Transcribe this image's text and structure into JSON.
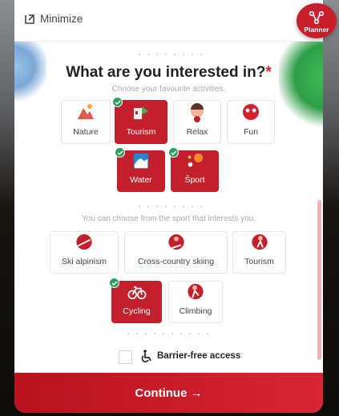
{
  "header": {
    "minimize_label": "Minimize",
    "planner_label": "Planner"
  },
  "main": {
    "title": "What are you interested in?",
    "required_mark": "*",
    "subtitle": "Choose your favourite activities.",
    "activities": [
      {
        "label": "Nature",
        "selected": false,
        "icon": "nature-icon"
      },
      {
        "label": "Tourism",
        "selected": true,
        "icon": "tourism-icon"
      },
      {
        "label": "Relax",
        "selected": false,
        "icon": "relax-icon"
      },
      {
        "label": "Fun",
        "selected": false,
        "icon": "fun-icon"
      },
      {
        "label": "Water",
        "selected": true,
        "icon": "water-icon"
      },
      {
        "label": "Šport",
        "selected": true,
        "icon": "sport-icon"
      }
    ],
    "sport_hint": "You can choose from the sport that interests you.",
    "sports": [
      {
        "label": "Ski alpinism",
        "selected": false,
        "icon": "ski-alpinism-icon"
      },
      {
        "label": "Cross-country skiing",
        "selected": false,
        "icon": "cross-country-skiing-icon"
      },
      {
        "label": "Tourism",
        "selected": false,
        "icon": "hiking-icon"
      },
      {
        "label": "Cycling",
        "selected": true,
        "icon": "cycling-icon"
      },
      {
        "label": "Climbing",
        "selected": false,
        "icon": "climbing-icon"
      }
    ],
    "barrier_free_label": "Barrier-free access",
    "continue_label": "Continue →"
  },
  "colors": {
    "accent": "#c3202c",
    "check": "#2f9e5b"
  }
}
